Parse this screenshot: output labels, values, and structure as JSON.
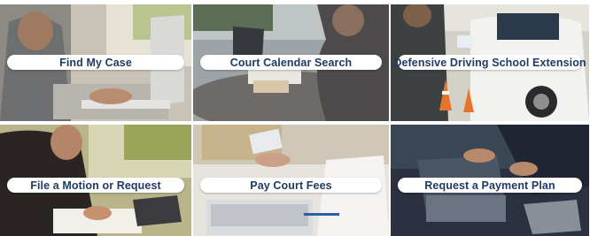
{
  "tiles": [
    {
      "label": "Find My Case"
    },
    {
      "label": "Court Calendar Search"
    },
    {
      "label": "Defensive Driving School Extension"
    },
    {
      "label": "File a Motion or Request"
    },
    {
      "label": "Pay Court Fees"
    },
    {
      "label": "Request a Payment Plan"
    }
  ],
  "colors": {
    "label_text": "#1f3b63",
    "label_bg": "#ffffff"
  }
}
